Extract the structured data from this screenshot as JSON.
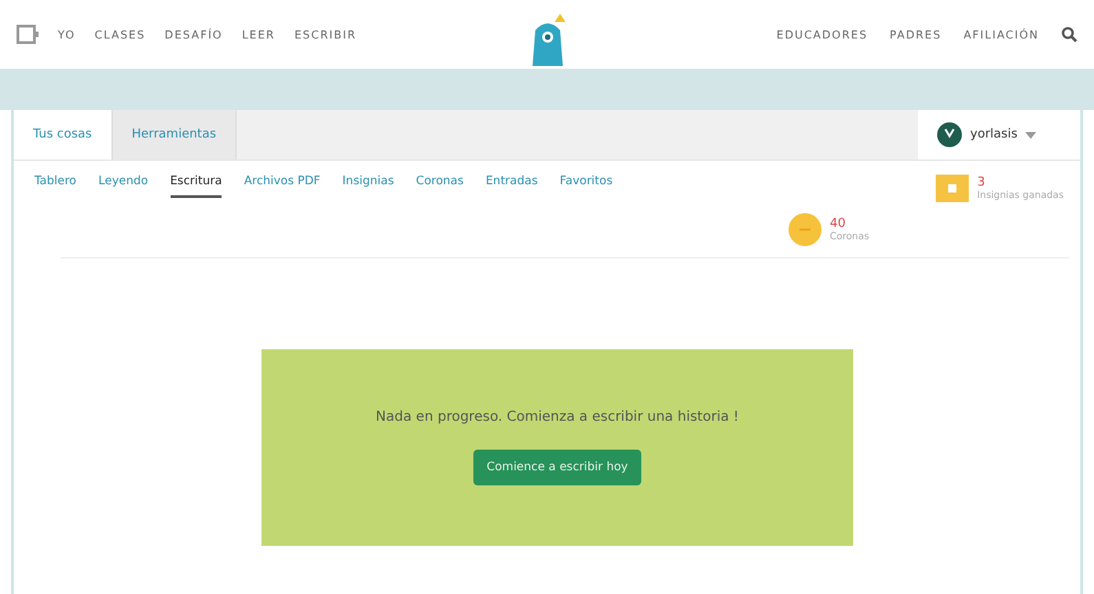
{
  "nav_left": [
    "YO",
    "CLASES",
    "DESAFÍO",
    "LEER",
    "ESCRIBIR"
  ],
  "nav_right": [
    "EDUCADORES",
    "PADRES",
    "AFILIACIÓN"
  ],
  "tabs": [
    {
      "label": "Tus cosas",
      "selected": true
    },
    {
      "label": "Herramientas",
      "selected": false
    }
  ],
  "user": {
    "name": "yorlasis"
  },
  "subnav": [
    {
      "label": "Tablero",
      "selected": false
    },
    {
      "label": "Leyendo",
      "selected": false
    },
    {
      "label": "Escritura",
      "selected": true
    },
    {
      "label": "Archivos PDF",
      "selected": false
    },
    {
      "label": "Insignias",
      "selected": false
    },
    {
      "label": "Coronas",
      "selected": false
    },
    {
      "label": "Entradas",
      "selected": false
    },
    {
      "label": "Favoritos",
      "selected": false
    }
  ],
  "stats": [
    {
      "kind": "badge",
      "value": "3",
      "label": "Insignias ganadas"
    },
    {
      "kind": "crown",
      "value": "40",
      "label": "Coronas"
    }
  ],
  "empty": {
    "message": "Nada en progreso. Comienza a escribir una historia !",
    "button": "Comience a escribir hoy"
  }
}
